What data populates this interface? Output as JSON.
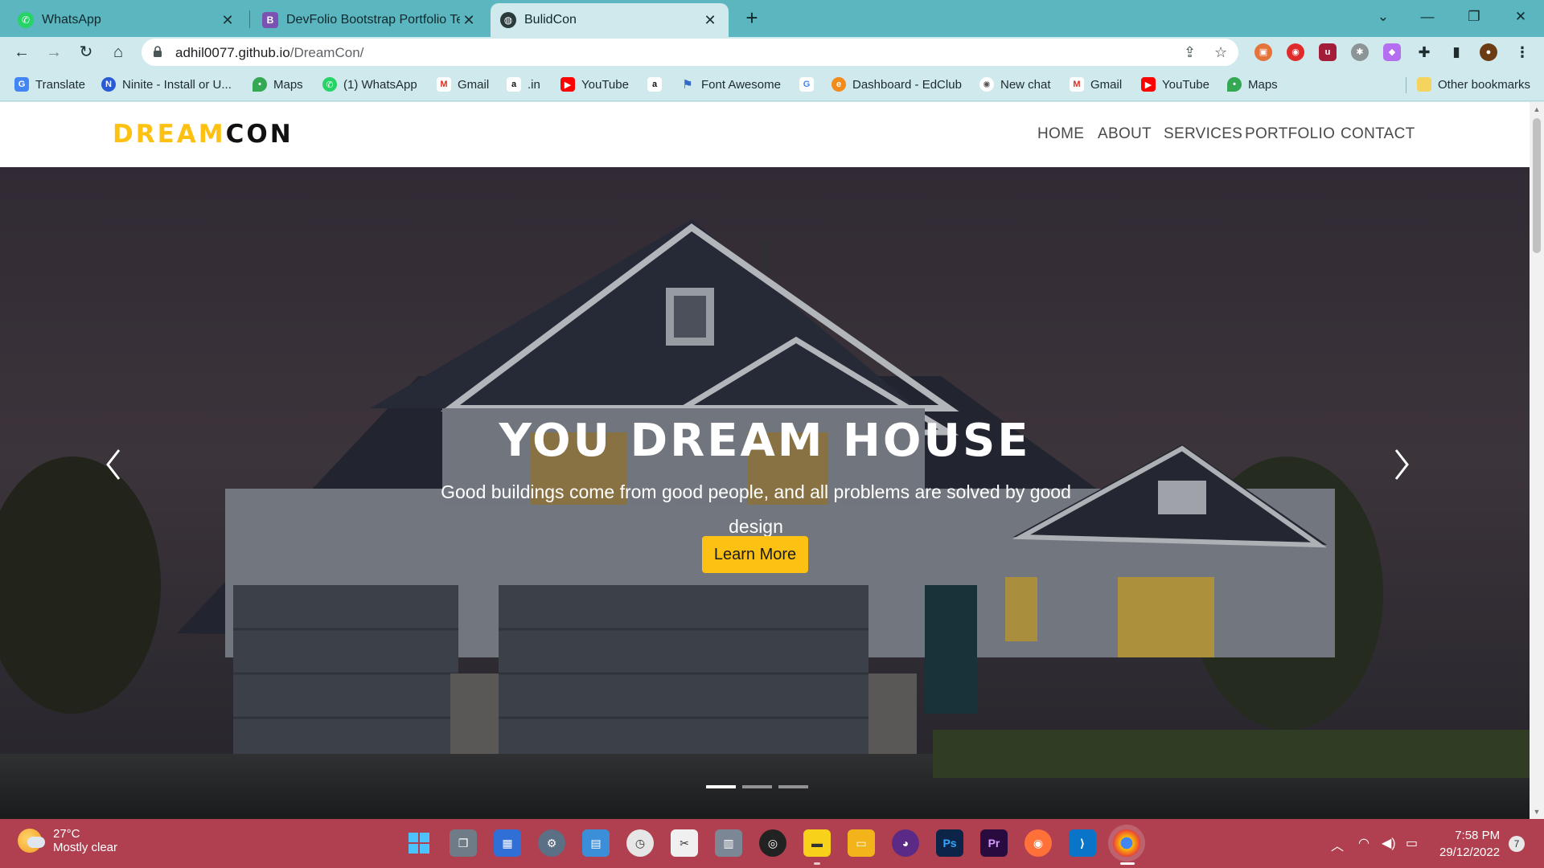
{
  "browser": {
    "tabs": [
      {
        "title": "WhatsApp",
        "icon": "whatsapp-icon"
      },
      {
        "title": "DevFolio Bootstrap Portfolio Tem",
        "icon": "bootstrap-icon"
      },
      {
        "title": "BulidCon",
        "icon": "globe-icon"
      }
    ],
    "url_host": "adhil0077.github.io",
    "url_path": "/DreamCon/",
    "bookmarks": [
      "Translate",
      "Ninite - Install or U...",
      "Maps",
      "(1) WhatsApp",
      "Gmail",
      ".in",
      "YouTube",
      "",
      "Font Awesome",
      "",
      "Dashboard - EdClub",
      "New chat",
      "Gmail",
      "YouTube",
      "Maps"
    ],
    "other_bookmarks": "Other bookmarks"
  },
  "site": {
    "logo_part1": "DREAM",
    "logo_part2": "CON",
    "menu": [
      "HOME",
      "ABOUT",
      "SERVICES",
      "PORTFOLIO",
      "CONTACT"
    ],
    "hero": {
      "title": "YOU DREAM HOUSE",
      "subtitle": "Good buildings come from good people, and all problems are solved by good design",
      "button": "Learn More",
      "slides": 3,
      "active_slide": 1
    },
    "accent": "#fdc113"
  },
  "taskbar": {
    "weather_temp": "27°C",
    "weather_desc": "Mostly clear",
    "time": "7:58 PM",
    "date": "29/12/2022",
    "notifications": "7"
  }
}
